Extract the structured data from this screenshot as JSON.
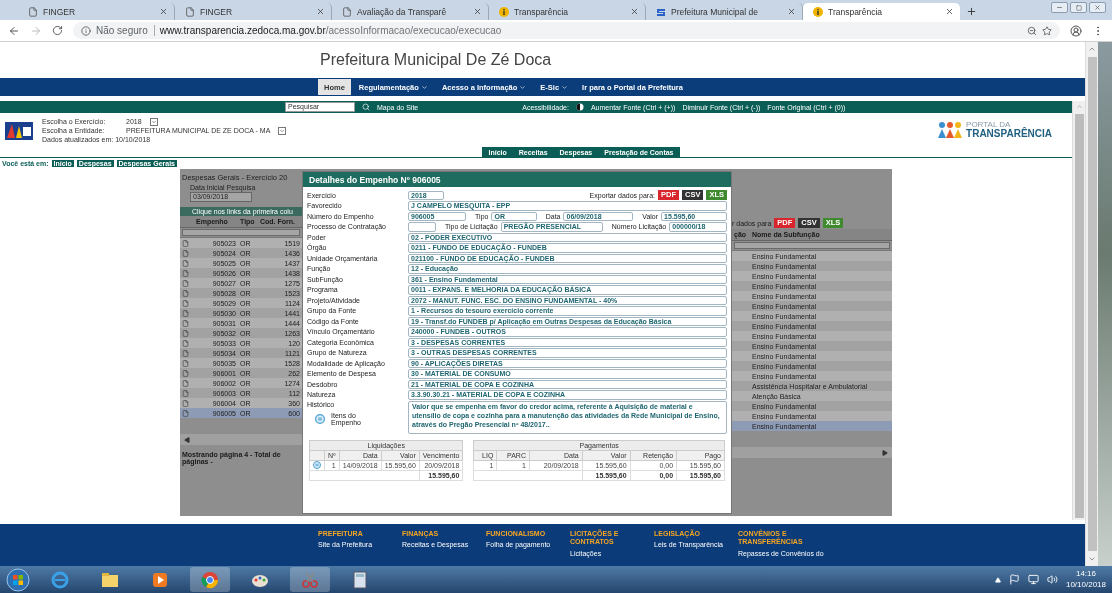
{
  "browser": {
    "tabs": [
      {
        "title": "FINGER",
        "kind": "page",
        "selected": false
      },
      {
        "title": "FINGER",
        "kind": "page",
        "selected": false
      },
      {
        "title": "Avaliação da Transparê",
        "kind": "page",
        "selected": false
      },
      {
        "title": "Transparência",
        "kind": "info",
        "selected": false
      },
      {
        "title": "Prefeitura Municipal de",
        "kind": "stripes",
        "selected": false
      },
      {
        "title": "Transparência",
        "kind": "info",
        "selected": true
      }
    ],
    "address": {
      "security": "Não seguro",
      "host": "www.transparencia.zedoca.ma.gov.br",
      "path": "/acessoInformacao/execucao/execucao"
    }
  },
  "page": {
    "title": "Prefeitura Municipal De Zé Doca",
    "nav": [
      {
        "label": "Home",
        "selected": true,
        "menu": false
      },
      {
        "label": "Regulamentação",
        "selected": false,
        "menu": true
      },
      {
        "label": "Acesso a Informação",
        "selected": false,
        "menu": true
      },
      {
        "label": "E-Sic",
        "selected": false,
        "menu": true
      },
      {
        "label": "Ir para o Portal da Prefeitura",
        "selected": false,
        "menu": false
      }
    ]
  },
  "portal": {
    "toolbar": {
      "search_value": "Pesquisar",
      "site_map": "Mapa do Site",
      "accessibility": "Acessibilidade:",
      "font_links": [
        "Aumentar Fonte (Ctrl + (+))",
        "Diminuir Fonte (Ctrl + (-))",
        "Fonte Original (Ctrl + (0))"
      ]
    },
    "filters": [
      {
        "label": "Escolha o Exercício:",
        "value": "2018"
      },
      {
        "label": "Escolha a Entidade:",
        "value": "PREFEITURA MUNICIPAL DE ZE DOCA - MA"
      }
    ],
    "updated": "Dados atualizados em: 10/10/2018",
    "logo": {
      "line1": "PORTAL DA",
      "line2": "TRANSPARÊNCIA"
    },
    "tabs": [
      {
        "label": "Início",
        "selected": false
      },
      {
        "label": "Receitas",
        "selected": false
      },
      {
        "label": "Despesas",
        "selected": false
      },
      {
        "label": "Prestação de Contas",
        "selected": false
      }
    ],
    "breadcrumb": {
      "prefix": "Você está em:",
      "items": [
        "Início",
        "Despesas",
        "Despesas Gerais"
      ]
    }
  },
  "list": {
    "title": "Despesas Gerais - Exercício 20",
    "date_label": "Data Inicial Pesquisa",
    "date_value": "03/09/2018",
    "hint": "Clique nos links da primeira colu",
    "columns": [
      "Empenho",
      "Tipo",
      "Cod. Forn."
    ],
    "right_export": "r dados para",
    "right_columns": [
      "ção",
      "Nome da Subfunção"
    ],
    "footer": "Mostrando página 4 - Total de páginas -",
    "exports": [
      {
        "label": "PDF",
        "kind": "pdf"
      },
      {
        "label": "CSV",
        "kind": "csv"
      },
      {
        "label": "XLS",
        "kind": "xls"
      }
    ],
    "rows": [
      {
        "empenho": "905023",
        "tipo": "OR",
        "cod": "1519",
        "subfuncao": "Ensino Fundamental",
        "selected": false
      },
      {
        "empenho": "905024",
        "tipo": "OR",
        "cod": "1436",
        "subfuncao": "Ensino Fundamental",
        "selected": false
      },
      {
        "empenho": "905025",
        "tipo": "OR",
        "cod": "1437",
        "subfuncao": "Ensino Fundamental",
        "selected": false
      },
      {
        "empenho": "905026",
        "tipo": "OR",
        "cod": "1438",
        "subfuncao": "Ensino Fundamental",
        "selected": false
      },
      {
        "empenho": "905027",
        "tipo": "OR",
        "cod": "1275",
        "subfuncao": "Ensino Fundamental",
        "selected": false
      },
      {
        "empenho": "905028",
        "tipo": "OR",
        "cod": "1523",
        "subfuncao": "Ensino Fundamental",
        "selected": false
      },
      {
        "empenho": "905029",
        "tipo": "OR",
        "cod": "1124",
        "subfuncao": "Ensino Fundamental",
        "selected": false
      },
      {
        "empenho": "905030",
        "tipo": "OR",
        "cod": "1441",
        "subfuncao": "Ensino Fundamental",
        "selected": false
      },
      {
        "empenho": "905031",
        "tipo": "OR",
        "cod": "1444",
        "subfuncao": "Ensino Fundamental",
        "selected": false
      },
      {
        "empenho": "905032",
        "tipo": "OR",
        "cod": "1263",
        "subfuncao": "Ensino Fundamental",
        "selected": false
      },
      {
        "empenho": "905033",
        "tipo": "OR",
        "cod": "120",
        "subfuncao": "Ensino Fundamental",
        "selected": false
      },
      {
        "empenho": "905034",
        "tipo": "OR",
        "cod": "1121",
        "subfuncao": "Ensino Fundamental",
        "selected": false
      },
      {
        "empenho": "905035",
        "tipo": "OR",
        "cod": "1528",
        "subfuncao": "Ensino Fundamental",
        "selected": false
      },
      {
        "empenho": "906001",
        "tipo": "OR",
        "cod": "262",
        "subfuncao": "Assistência Hospitalar e Ambulatorial",
        "selected": false
      },
      {
        "empenho": "906002",
        "tipo": "OR",
        "cod": "1274",
        "subfuncao": "Atenção Básica",
        "selected": false
      },
      {
        "empenho": "906003",
        "tipo": "OR",
        "cod": "112",
        "subfuncao": "Ensino Fundamental",
        "selected": false
      },
      {
        "empenho": "906004",
        "tipo": "OR",
        "cod": "360",
        "subfuncao": "Ensino Fundamental",
        "selected": false
      },
      {
        "empenho": "906005",
        "tipo": "OR",
        "cod": "600",
        "subfuncao": "Ensino Fundamental",
        "selected": true
      }
    ]
  },
  "modal": {
    "title": "Detalhes do Empenho Nº 906005",
    "exercicio": {
      "label": "Exercício",
      "value": "2018"
    },
    "export_label": "Exportar dados para:",
    "exports": [
      {
        "label": "PDF",
        "kind": "pdf"
      },
      {
        "label": "CSV",
        "kind": "csv"
      },
      {
        "label": "XLS",
        "kind": "xls"
      }
    ],
    "favorecido": {
      "label": "Favorecido",
      "value": "J CAMPELO MESQUITA - EPP"
    },
    "empenho_line": [
      {
        "label": "Número do Empenho",
        "value": "906005"
      },
      {
        "label": "Tipo",
        "value": "OR"
      },
      {
        "label": "Data",
        "value": "06/09/2018"
      },
      {
        "label": "Valor",
        "value": "15.595,60"
      }
    ],
    "licitacao_line": [
      {
        "label": "Processo de Contratação"
      },
      {
        "label": "Tipo de Licitação",
        "value": "PREGÃO PRESENCIAL"
      },
      {
        "label": "Número Licitação",
        "value": "000000/18"
      }
    ],
    "fields": [
      {
        "label": "Poder",
        "value": "02 - PODER EXECUTIVO"
      },
      {
        "label": "Órgão",
        "value": "0211 - FUNDO DE EDUCAÇÃO - FUNDEB"
      },
      {
        "label": "Unidade Orçamentária",
        "value": "021100 - FUNDO DE EDUCAÇÃO - FUNDEB"
      },
      {
        "label": "Função",
        "value": "12 - Educação"
      },
      {
        "label": "SubFunção",
        "value": "361 - Ensino Fundamental"
      },
      {
        "label": "Programa",
        "value": "0011 - EXPANS. E MELHORIA DA EDUCAÇÃO BÁSICA"
      },
      {
        "label": "Projeto/Atividade",
        "value": "2072 - MANUT. FUNC. ESC. DO ENSINO FUNDAMENTAL - 40%"
      },
      {
        "label": "Grupo da Fonte",
        "value": "1 - Recursos do tesouro exercício corrente"
      },
      {
        "label": "Código da Fonte",
        "value": "19 - Transf.do FUNDEB p/ Aplicação em Outras Despesas da Educação Básica"
      },
      {
        "label": "Vínculo Orçamentário",
        "value": "240000 - FUNDEB - OUTROS"
      },
      {
        "label": "Categoria Econômica",
        "value": "3 - DESPESAS CORRENTES"
      },
      {
        "label": "Grupo de Natureza",
        "value": "3 - OUTRAS DESPESAS CORRENTES"
      },
      {
        "label": "Modalidade de Aplicação",
        "value": "90 - APLICAÇÕES DIRETAS"
      },
      {
        "label": "Elemento de Despesa",
        "value": "30 - MATERIAL DE CONSUMO"
      },
      {
        "label": "Desdobro",
        "value": "21 - MATERIAL DE COPA E COZINHA"
      },
      {
        "label": "Natureza",
        "value": "3.3.90.30.21 - MATERIAL DE COPA E COZINHA"
      }
    ],
    "historico": {
      "label": "Histórico",
      "value": "Valor que se empenha em favor do credor acima, referente à Aquisição de material e utensílio de copa e cozinha para a manutenção das atividades da Rede Municipal de Ensino, através do Pregão Presencial nº 48/2017.."
    },
    "items_label": "Itens do Empenho",
    "liquidacoes": {
      "title": "Liquidações",
      "columns": [
        "Nº",
        "Data",
        "Valor",
        "Vencimento"
      ],
      "rows": [
        [
          "1",
          "14/09/2018",
          "15.595,60",
          "20/09/2018"
        ]
      ],
      "totals": [
        "15.595,60"
      ]
    },
    "pagamentos": {
      "title": "Pagamentos",
      "columns": [
        "LIQ",
        "PARC",
        "Data",
        "Valor",
        "Retenção",
        "Pago"
      ],
      "rows": [
        [
          "1",
          "1",
          "20/09/2018",
          "15.595,60",
          "0,00",
          "15.595,60"
        ]
      ],
      "totals": [
        "15.595,60",
        "0,00",
        "15.595,60"
      ]
    }
  },
  "footer": [
    {
      "heading": "PREFEITURA",
      "link": "Site da Prefeitura"
    },
    {
      "heading": "FINANÇAS",
      "link": "Receitas e Despesas"
    },
    {
      "heading": "FUNCIONALISMO",
      "link": "Folha de pagamento"
    },
    {
      "heading": "LICITAÇÕES E CONTRATOS",
      "link": "Licitações"
    },
    {
      "heading": "LEGISLAÇÃO",
      "link": "Leis de Transparência"
    },
    {
      "heading": "CONVÊNIOS E TRANSFERÊNCIAS",
      "link": "Repasses de Convênios do"
    }
  ],
  "taskbar": {
    "time": "14:16",
    "date": "10/10/2018"
  }
}
